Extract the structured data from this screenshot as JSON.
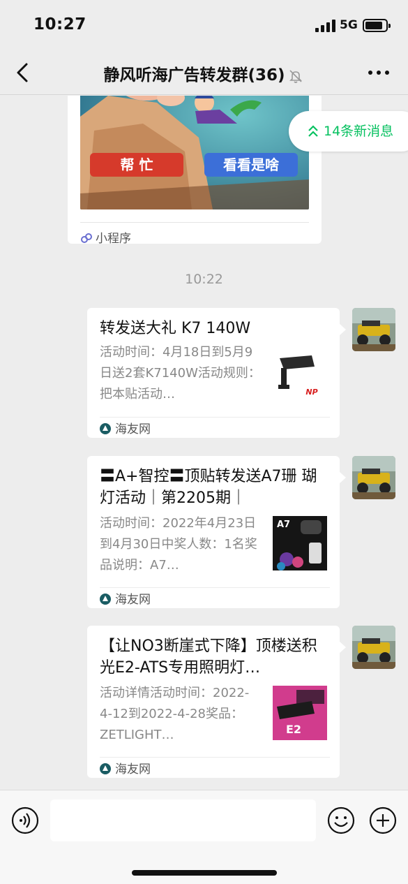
{
  "status_bar": {
    "time": "10:27",
    "network": "5G"
  },
  "nav": {
    "title": "静风听海广告转发群(36)"
  },
  "mini_program": {
    "buttons": [
      "帮 忙",
      "看看是啥"
    ],
    "footer_label": "小程序"
  },
  "new_messages_pill": "14条新消息",
  "timestamp": "10:22",
  "messages": [
    {
      "title": "转发送大礼 K7 140W",
      "desc": "活动时间：4月18日到5月9日送2套K7140W活动规则：把本贴活动…",
      "thumb_text": "NP",
      "source": "海友网"
    },
    {
      "title": "〓A+智控〓顶贴转发送A7珊 瑚灯活动｜第2205期｜",
      "desc": "活动时间：2022年4月23日到4月30日中奖人数：1名奖品说明：A7…",
      "thumb_text": "A7",
      "source": "海友网"
    },
    {
      "title": "【让NO3断崖式下降】顶楼送积光E2-ATS专用照明灯…",
      "desc": "活动详情活动时间：2022-4-12到2022-4-28奖品：ZETLIGHT…",
      "thumb_text": "E2",
      "source": "海友网"
    }
  ],
  "colors": {
    "accent_green": "#07c160",
    "background": "#ededed"
  }
}
